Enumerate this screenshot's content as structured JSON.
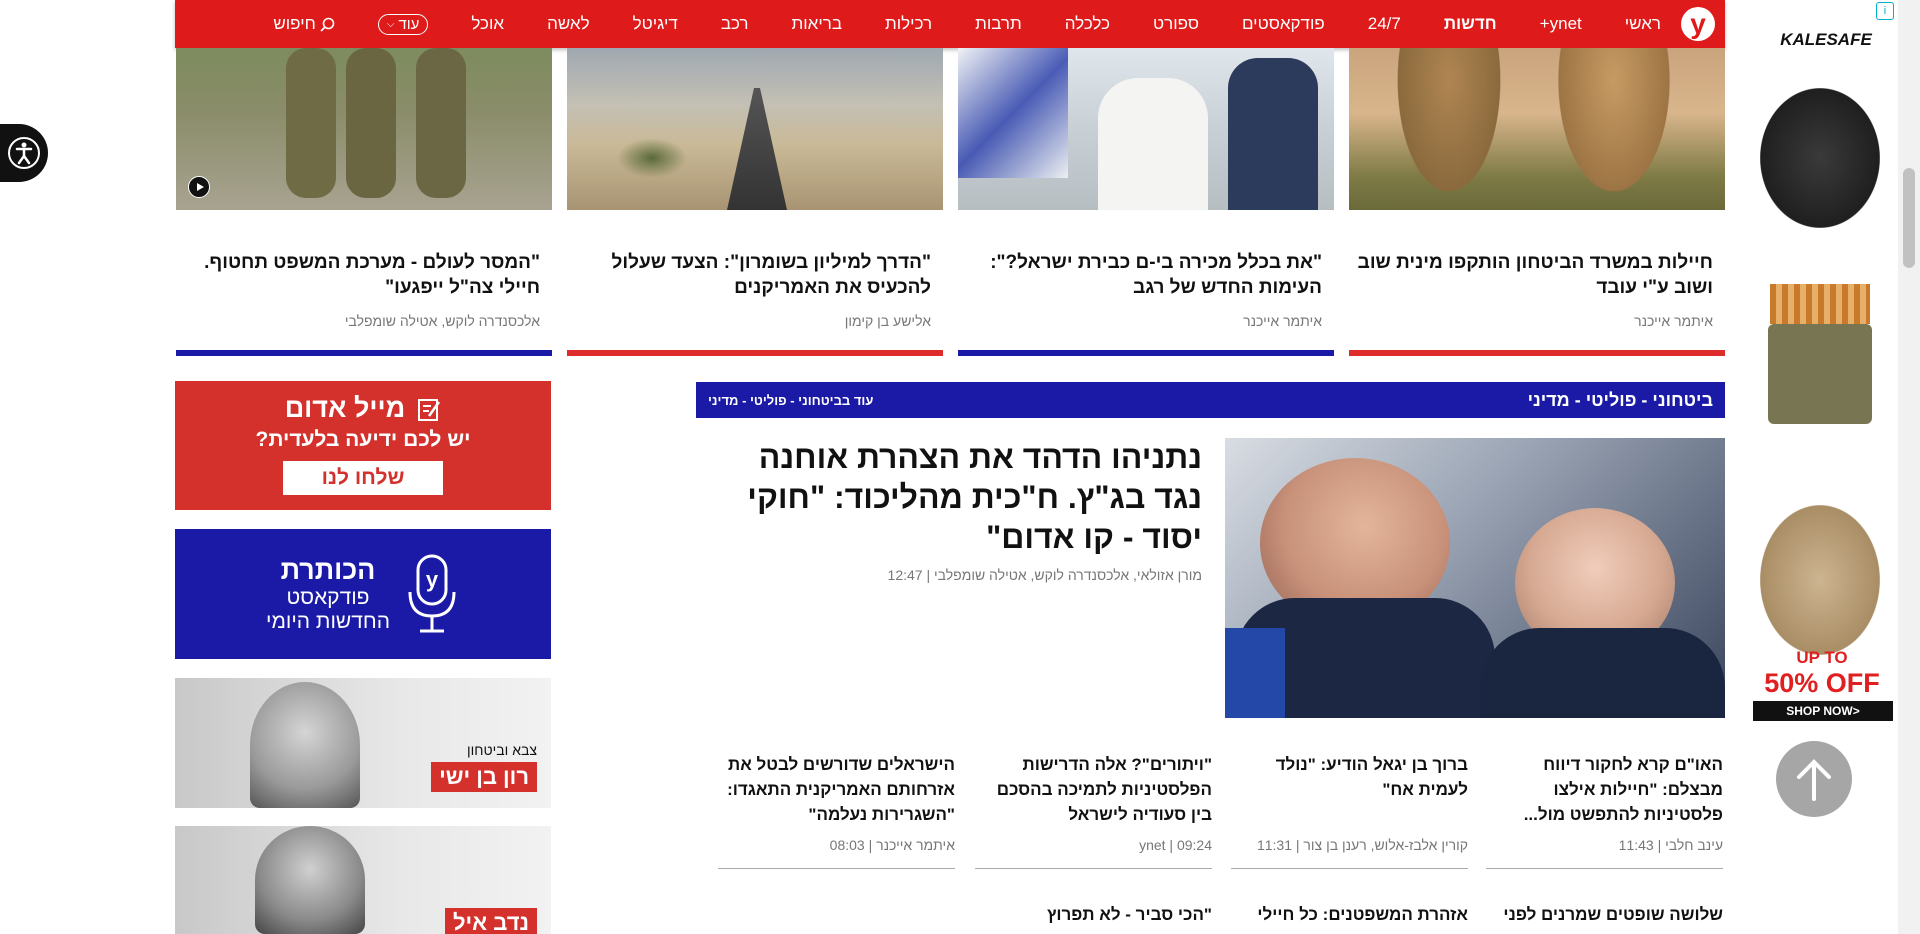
{
  "nav": {
    "logo": "y",
    "items": [
      "ראשי",
      "ynet+",
      "חדשות",
      "24/7",
      "פודקאסטים",
      "ספורט",
      "כלכלה",
      "תרבות",
      "רכילות",
      "בריאות",
      "רכב",
      "דיגיטל",
      "לאשה",
      "אוכל"
    ],
    "more": "עוד",
    "search": "חיפוש"
  },
  "top_articles": [
    {
      "title": "חיילות במשרד הביטחון הותקפו מינית שוב ושוב ע\"י עובד",
      "author": "איתמר אייכנר",
      "bar_color": "#de2b2b"
    },
    {
      "title": "\"את בכלל מכירה בי-ם כבירת ישראל?\": העימות החדש של רגב",
      "author": "איתמר אייכנר",
      "bar_color": "#1a1aa6"
    },
    {
      "title": "\"הדרך למיליון בשומרון\": הצעד שעלול להכעיס את האמריקנים",
      "author": "אלישע בן קימון",
      "bar_color": "#de2b2b"
    },
    {
      "title": "\"המסר לעולם - מערכת המשפט תחטוף. חיילי צה\"ל ייפגעו\"",
      "author": "אלכסנדרה לוקש, אטילה שומפלבי",
      "bar_color": "#1a1aa6"
    }
  ],
  "section": {
    "title": "ביטחוני - פוליטי - מדיני",
    "more": "עוד בביטחוני - פוליטי - מדיני"
  },
  "main_story": {
    "title": "נתניהו הדהד את הצהרת אוחנה נגד בג\"ץ. ח\"כית מהליכוד: \"חוקי יסוד - קו אדום\"",
    "meta": "מורן אזולאי, אלכסנדרה לוקש, אטילה שומפלבי | 12:47"
  },
  "sub_stories": [
    {
      "title": "האו\"ם קרא לחקור דיווח מבצלם: \"חיילות אילצו פלסטיניות להתפשט מול...",
      "meta": "עינב חלבי | 11:43"
    },
    {
      "title": "ברוך בן יגאל הודיע: \"נולד לעמית אח\"",
      "meta": "קורין אלבז-אלוש, רענן בן צור | 11:31"
    },
    {
      "title": "\"ויתורים\"? אלה הדרישות הפלסטיניות לתמיכה בהסכם בין סעודיה לישראל",
      "meta": "ynet | 09:24"
    },
    {
      "title": "הישראלים שדורשים לבטל את אזרחותם האמריקנית התאגדו: \"השגרירות נעלמה\"",
      "meta": "איתמר אייכנר | 08:03"
    }
  ],
  "sub_stories_2": [
    "שלושה שופטים שמרנים לפני",
    "אזהרת המשפטנים: כל חיילי",
    "\"הכי סביר - לא תפרוץ"
  ],
  "promos": {
    "red_mail": {
      "title": "מייל אדום",
      "subtitle": "יש לכם ידיעה בלעדית?",
      "button": "שלחו לנו"
    },
    "podcast": {
      "title": "הכותרת",
      "line1": "פודקאסט",
      "line2": "החדשות היומי"
    },
    "columnist1": {
      "section": "צבא וביטחון",
      "name": "רון בן ישי"
    },
    "columnist2": {
      "name": "נדב איל"
    }
  },
  "ads": {
    "brand": "KALESAFE",
    "offer_top": "UP TO",
    "offer_main": "50% OFF",
    "shop": "SHOP NOW>"
  }
}
